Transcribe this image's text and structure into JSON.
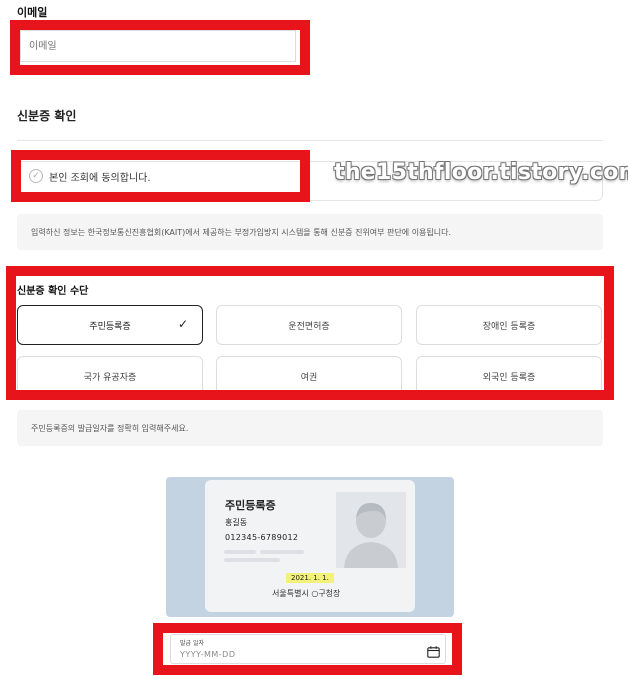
{
  "email": {
    "label": "이메일",
    "placeholder": "이메일"
  },
  "identity": {
    "section_title": "신분증 확인",
    "agree_text": "본인 조회에 동의합니다.",
    "notice": "입력하신 정보는 한국정보통신진흥협회(KAIT)에서 제공하는 부정가입방지 시스템을 통해 신분증 진위여부 판단에 이용됩니다."
  },
  "watermark": "the15thfloor.tistory.com",
  "method": {
    "title": "신분증 확인 수단",
    "selected": "주민등록증",
    "options": [
      "주민등록증",
      "운전면허증",
      "장애인 등록증",
      "국가 유공자증",
      "여권",
      "외국인 등록증"
    ],
    "hint": "주민등록증의 발급일자를 정확히 입력해주세요."
  },
  "sample_card": {
    "title": "주민등록증",
    "name": "홍길동",
    "number": "012345-6789012",
    "date": "2021. 1. 1.",
    "issuer": "서울특별시 ○구청장"
  },
  "issue_date": {
    "label": "발급 일자",
    "placeholder": "YYYY-MM-DD",
    "icon": "calendar-icon"
  },
  "colors": {
    "highlight_red": "#e8141b",
    "card_background": "#c4d3e2",
    "date_highlight": "#f2f27a"
  }
}
